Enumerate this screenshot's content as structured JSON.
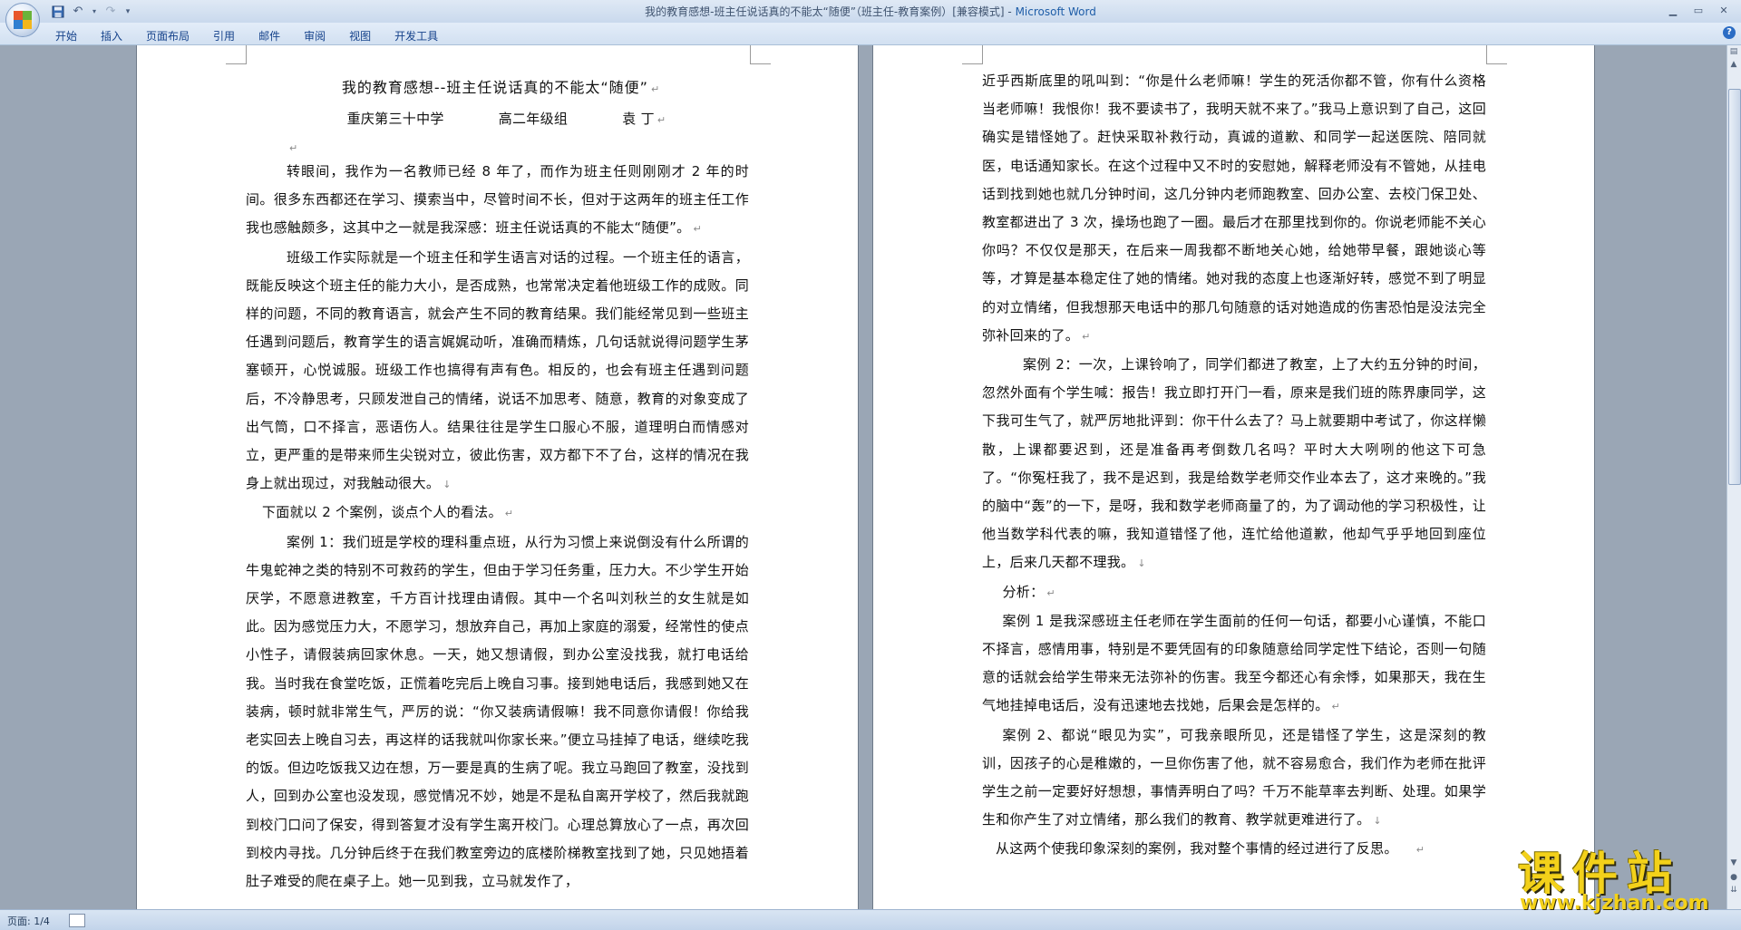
{
  "window": {
    "title_doc": "我的教育感想-班主任说话真的不能太“随便”（班主任-教育案例）[兼容模式] - ",
    "title_app": "Microsoft Word"
  },
  "ribbon": {
    "tabs": [
      "开始",
      "插入",
      "页面布局",
      "引用",
      "邮件",
      "审阅",
      "视图",
      "开发工具"
    ]
  },
  "document": {
    "title": "我的教育感想--班主任说话真的不能太“随便”",
    "byline": [
      "重庆第三十中学",
      "高二年级组",
      "袁  丁"
    ],
    "left_paragraphs": [
      "转眼间，我作为一名教师已经 8 年了，而作为班主任则刚刚才 2 年的时间。很多东西都还在学习、摸索当中，尽管时间不长，但对于这两年的班主任工作我也感触颇多，这其中之一就是我深感：班主任说话真的不能太“随便”。",
      "班级工作实际就是一个班主任和学生语言对话的过程。一个班主任的语言，既能反映这个班主任的能力大小，是否成熟，也常常决定着他班级工作的成败。同样的问题，不同的教育语言，就会产生不同的教育结果。我们能经常见到一些班主任遇到问题后，教育学生的语言娓娓动听，准确而精炼，几句话就说得问题学生茅塞顿开，心悦诚服。班级工作也搞得有声有色。相反的，也会有班主任遇到问题后，不冷静思考，只顾发泄自己的情绪，说话不加思考、随意，教育的对象变成了出气筒，口不择言，恶语伤人。结果往往是学生口服心不服，道理明白而情感对立，更严重的是带来师生尖锐对立，彼此伤害，双方都下不了台，这样的情况在我身上就出现过，对我触动很大。",
      "下面就以 2 个案例，谈点个人的看法。",
      "案例 1：我们班是学校的理科重点班，从行为习惯上来说倒没有什么所谓的牛鬼蛇神之类的特别不可救药的学生，但由于学习任务重，压力大。不少学生开始厌学，不愿意进教室，千方百计找理由请假。其中一个名叫刘秋兰的女生就是如此。因为感觉压力大，不愿学习，想放弃自己，再加上家庭的溺爱，经常性的使点小性子，请假装病回家休息。一天，她又想请假，到办公室没找我，就打电话给我。当时我在食堂吃饭，正慌着吃完后上晚自习事。接到她电话后，我感到她又在装病，顿时就非常生气，严厉的说：“你又装病请假嘛！我不同意你请假！你给我老实回去上晚自习去，再这样的话我就叫你家长来。”便立马挂掉了电话，继续吃我的饭。但边吃饭我又边在想，万一要是真的生病了呢。我立马跑回了教室，没找到人，回到办公室也没发现，感觉情况不妙，她是不是私自离开学校了，然后我就跑到校门口问了保安，得到答复才没有学生离开校门。心理总算放心了一点，再次回到校内寻找。几分钟后终于在我们教室旁边的底楼阶梯教室找到了她，只见她捂着肚子难受的爬在桌子上。她一见到我，立马就发作了，"
    ],
    "right_paragraphs": [
      "近乎西斯底里的吼叫到：“你是什么老师嘛！学生的死活你都不管，你有什么资格当老师嘛！我恨你！我不要读书了，我明天就不来了。”我马上意识到了自己，这回确实是错怪她了。赶快采取补救行动，真诚的道歉、和同学一起送医院、陪同就医，电话通知家长。在这个过程中又不时的安慰她，解释老师没有不管她，从挂电话到找到她也就几分钟时间，这几分钟内老师跑教室、回办公室、去校门保卫处、教室都进出了 3 次，操场也跑了一圈。最后才在那里找到你的。你说老师能不关心你吗？不仅仅是那天，在后来一周我都不断地关心她，给她带早餐，跟她谈心等等，才算是基本稳定住了她的情绪。她对我的态度上也逐渐好转，感觉不到了明显的对立情绪，但我想那天电话中的那几句随意的话对她造成的伤害恐怕是没法完全弥补回来的了。",
      "案例 2：一次，上课铃响了，同学们都进了教室，上了大约五分钟的时间，忽然外面有个学生喊：报告！我立即打开门一看，原来是我们班的陈界康同学，这下我可生气了，就严厉地批评到：你干什么去了？马上就要期中考试了，你这样懒散，上课都要迟到，还是准备再考倒数几名吗？平时大大咧咧的他这下可急了。“你冤枉我了，我不是迟到，我是给数学老师交作业本去了，这才来晚的。”我的脑中“轰”的一下，是呀，我和数学老师商量了的，为了调动他的学习积极性，让他当数学科代表的嘛，我知道错怪了他，连忙给他道歉，他却气乎乎地回到座位上，后来几天都不理我。",
      "分析：",
      "案例 1 是我深感班主任老师在学生面前的任何一句话，都要小心谨慎，不能口不择言，感情用事，特别是不要凭固有的印象随意给同学定性下结论，否则一句随意的话就会给学生带来无法弥补的伤害。我至今都还心有余悸，如果那天，我在生气地挂掉电话后，没有迅速地去找她，后果会是怎样的。",
      "案例 2、都说“眼见为实”，可我亲眼所见，还是错怪了学生，这是深刻的教训，因孩子的心是稚嫩的，一旦你伤害了他，就不容易愈合，我们作为老师在批评学生之前一定要好好想想，事情弄明白了吗？千万不能草率去判断、处理。如果学生和你产生了对立情绪，那么我们的教育、教学就更难进行了。",
      "从这两个使我印象深刻的案例，我对整个事情的经过进行了反思。"
    ]
  },
  "status": {
    "page": "页面: 1/4"
  },
  "watermark": {
    "text": "课件站",
    "url": "www.kjzhan.com"
  },
  "colors": {
    "ribbon_text": "#15428b",
    "app_title": "#1f5ea8",
    "watermark": "#f3d11a"
  }
}
